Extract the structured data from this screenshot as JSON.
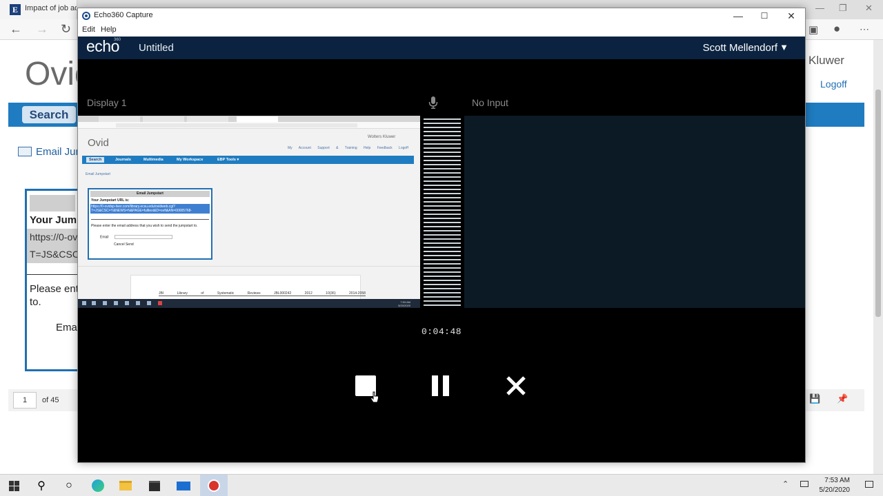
{
  "background_browser": {
    "tab_title": "Impact of job adj",
    "favicon": "E",
    "site_logo": "Ovic",
    "search_button": "Search",
    "brand_text": "Kluwer",
    "logoff_link": "Logoff",
    "email_link": "Email Jum",
    "dialog": {
      "heading": "Your Jum",
      "url_line1": "https://0-ov",
      "url_line2": "T=JS&CSC",
      "prompt_line1": "Please ent",
      "prompt_line2": "to.",
      "email_label": "Ema"
    },
    "page_number": "1",
    "page_total": "of 45"
  },
  "echo_window": {
    "title": "Echo360 Capture",
    "menu": [
      "Edit",
      "Help"
    ],
    "brand": "echo",
    "brand_superscript": "360",
    "document_title": "Untitled",
    "user_name": "Scott Mellendorf",
    "display_label": "Display 1",
    "audio_label": "No Input",
    "timer": "0:04:48",
    "colors": {
      "header": "#0b2340",
      "panel": "#0c1a25",
      "background": "#000000"
    }
  },
  "preview_mini": {
    "logo": "Ovid",
    "kluwer": "Wolters Kluwer",
    "links": "My Account  Support & Training  Help  Feedback  Logoff",
    "nav": [
      "Search",
      "Journals",
      "Multimedia",
      "My Workspace",
      "EBP Tools ▾"
    ],
    "email_link": "Email Jumpstart",
    "dialog_title": "Email Jumpstart",
    "dialog_heading": "Your Jumpstart URL is:",
    "dialog_url_1": "https://0-ovidsp-liver.com/library.ecsu.edu/ovidweb.cgi?",
    "dialog_url_2": "T=JS&CSC=Y&NEWS=N&PAGE=fulltext&D=ovft&AN=00005768-",
    "dialog_prompt": "Please enter the email address that you wish to send the jumpstart to.",
    "dialog_email_label": "Email",
    "dialog_buttons": "Cancel  Send",
    "doc_row": "JBI Library of Systematic Reviews  JBL000242  2012 10(36) 2014-2058"
  },
  "taskbar": {
    "time": "7:53 AM",
    "date": "5/20/2020"
  }
}
